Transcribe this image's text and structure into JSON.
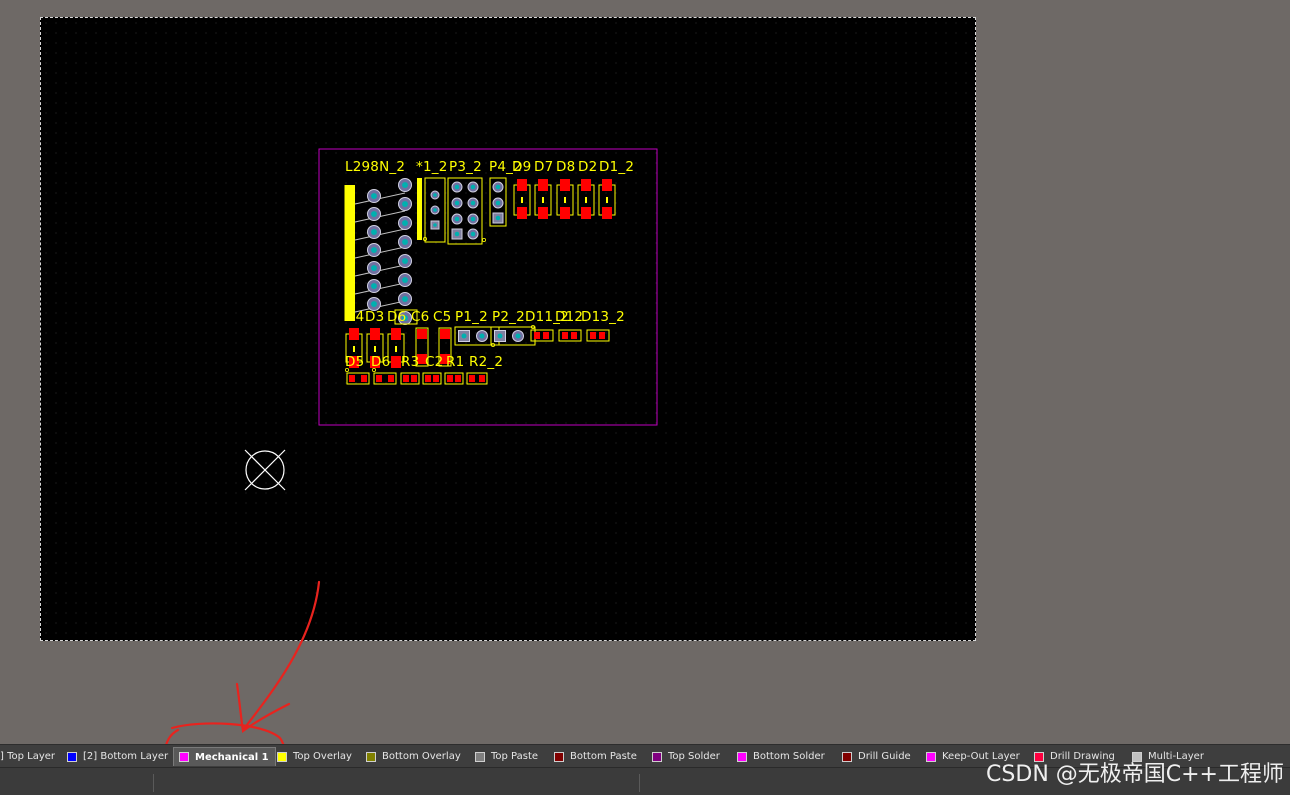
{
  "canvas": {
    "designators": {
      "l298n": "L298N_2",
      "x1": "*1_2",
      "p3": "P3_2",
      "p4": "P4_2",
      "d9": "D9",
      "d7": "D7",
      "d8": "D8",
      "d2": "D2",
      "d1": "D1_2",
      "d4": "D4",
      "d3": "D3",
      "d6c": "D6",
      "c6": "C6",
      "c5": "C5",
      "p1": "P1_2",
      "p2": "P2_2",
      "d11": "D11_2",
      "d12": "D12",
      "d13": "D13_2",
      "d5": "D5",
      "d6": "D6",
      "r3": "R3",
      "c2": "C2",
      "r1": "R1",
      "r2": "R2_2"
    },
    "colors": {
      "board": "#000000",
      "overlay": "#ffff00",
      "pad": "#ff0000",
      "outline": "#c000c0",
      "hole": "#00b0b0"
    },
    "origin_marker": "origin-cross-icon"
  },
  "layer_tabs": [
    {
      "label": "] Top Layer",
      "color": "#ff0000"
    },
    {
      "label": "[2] Bottom Layer",
      "color": "#0000ff"
    },
    {
      "label": "Mechanical 1",
      "color": "#ff00ff",
      "active": true
    },
    {
      "label": "Top Overlay",
      "color": "#ffff00"
    },
    {
      "label": "Bottom Overlay",
      "color": "#808000"
    },
    {
      "label": "Top Paste",
      "color": "#808080"
    },
    {
      "label": "Bottom Paste",
      "color": "#800000"
    },
    {
      "label": "Top Solder",
      "color": "#800080"
    },
    {
      "label": "Bottom Solder",
      "color": "#ff00ff"
    },
    {
      "label": "Drill Guide",
      "color": "#800000"
    },
    {
      "label": "Keep-Out Layer",
      "color": "#ff00ff"
    },
    {
      "label": "Drill Drawing",
      "color": "#ff0040"
    },
    {
      "label": "Multi-Layer",
      "color": "#c0c0c0"
    }
  ],
  "watermark": "CSDN @无极帝国C++工程师"
}
